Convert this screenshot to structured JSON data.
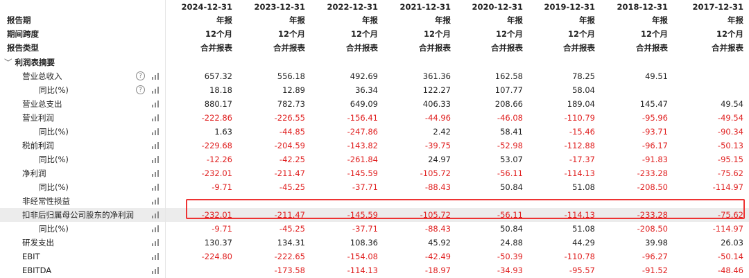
{
  "header": {
    "columns": [
      "2024-12-31",
      "2023-12-31",
      "2022-12-31",
      "2021-12-31",
      "2020-12-31",
      "2019-12-31",
      "2018-12-31",
      "2017-12-31"
    ],
    "meta_rows": [
      {
        "label": "报告期",
        "values": [
          "年报",
          "年报",
          "年报",
          "年报",
          "年报",
          "年报",
          "年报",
          "年报"
        ]
      },
      {
        "label": "期间跨度",
        "values": [
          "12个月",
          "12个月",
          "12个月",
          "12个月",
          "12个月",
          "12个月",
          "12个月",
          "12个月"
        ]
      },
      {
        "label": "报告类型",
        "values": [
          "合并报表",
          "合并报表",
          "合并报表",
          "合并报表",
          "合并报表",
          "合并报表",
          "合并报表",
          "合并报表"
        ]
      }
    ]
  },
  "section": {
    "chevron": "﹀",
    "title": "利润表摘要"
  },
  "rows": [
    {
      "label": "营业总收入",
      "values": [
        "657.32",
        "556.18",
        "492.69",
        "361.36",
        "162.58",
        "78.25",
        "49.51",
        ""
      ],
      "help": true
    },
    {
      "label": "同比(%)",
      "sub": true,
      "values": [
        "18.18",
        "12.89",
        "36.34",
        "122.27",
        "107.77",
        "58.04",
        "",
        ""
      ],
      "help": true
    },
    {
      "label": "营业总支出",
      "values": [
        "880.17",
        "782.73",
        "649.09",
        "406.33",
        "208.66",
        "189.04",
        "145.47",
        "49.54"
      ]
    },
    {
      "label": "营业利润",
      "values": [
        "-222.86",
        "-226.55",
        "-156.41",
        "-44.96",
        "-46.08",
        "-110.79",
        "-95.96",
        "-49.54"
      ]
    },
    {
      "label": "同比(%)",
      "sub": true,
      "values": [
        "1.63",
        "-44.85",
        "-247.86",
        "2.42",
        "58.41",
        "-15.46",
        "-93.71",
        "-90.34"
      ]
    },
    {
      "label": "税前利润",
      "values": [
        "-229.68",
        "-204.59",
        "-143.82",
        "-39.75",
        "-52.98",
        "-112.88",
        "-96.17",
        "-50.13"
      ]
    },
    {
      "label": "同比(%)",
      "sub": true,
      "values": [
        "-12.26",
        "-42.25",
        "-261.84",
        "24.97",
        "53.07",
        "-17.37",
        "-91.83",
        "-95.15"
      ]
    },
    {
      "label": "净利润",
      "values": [
        "-232.01",
        "-211.47",
        "-145.59",
        "-105.72",
        "-56.11",
        "-114.13",
        "-233.28",
        "-75.62"
      ]
    },
    {
      "label": "同比(%)",
      "sub": true,
      "values": [
        "-9.71",
        "-45.25",
        "-37.71",
        "-88.43",
        "50.84",
        "51.08",
        "-208.50",
        "-114.97"
      ]
    },
    {
      "label": "非经常性损益",
      "values": [
        "",
        "",
        "",
        "",
        "",
        "",
        "",
        ""
      ]
    },
    {
      "label": "扣非后归属母公司股东的净利润",
      "values": [
        "-232.01",
        "-211.47",
        "-145.59",
        "-105.72",
        "-56.11",
        "-114.13",
        "-233.28",
        "-75.62"
      ],
      "highlight": true
    },
    {
      "label": "同比(%)",
      "sub": true,
      "values": [
        "-9.71",
        "-45.25",
        "-37.71",
        "-88.43",
        "50.84",
        "51.08",
        "-208.50",
        "-114.97"
      ]
    },
    {
      "label": "研发支出",
      "values": [
        "130.37",
        "134.31",
        "108.36",
        "45.92",
        "24.88",
        "44.29",
        "39.98",
        "26.03"
      ]
    },
    {
      "label": "EBIT",
      "values": [
        "-224.80",
        "-222.65",
        "-154.08",
        "-42.49",
        "-50.39",
        "-110.78",
        "-96.27",
        "-50.14"
      ]
    },
    {
      "label": "EBITDA",
      "values": [
        "",
        "-173.58",
        "-114.13",
        "-18.97",
        "-34.93",
        "-95.57",
        "-91.52",
        "-48.46"
      ]
    }
  ],
  "icons": {
    "help": "question-circle-icon",
    "chart": "bar-chart-icon"
  },
  "colors": {
    "negative": "#e02020",
    "highlight_border": "#e33333",
    "shaded_row": "#ececec"
  }
}
